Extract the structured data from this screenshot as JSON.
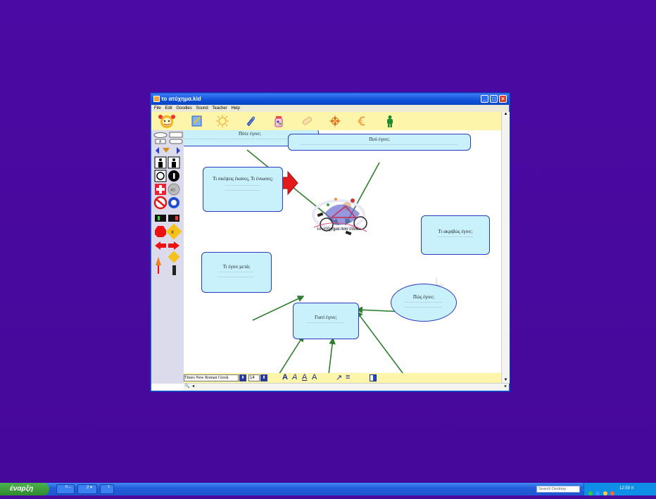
{
  "window": {
    "title": "το ατύχημα.kid",
    "menu": [
      "File",
      "Edit",
      "Goodies",
      "Sound",
      "Teacher",
      "Help"
    ]
  },
  "toolbar": {
    "icons": [
      "kid-avatar-icon",
      "notepad-icon",
      "sun-icon",
      "paperclip-icon",
      "jar-icon",
      "eraser-icon",
      "compass-icon",
      "euro-icon",
      "person-icon"
    ]
  },
  "diagram": {
    "center_caption": "το ατύχημα που είδα",
    "boxes": {
      "when": {
        "text": "Πότε έγινε;",
        "dots": "................................................................................................................"
      },
      "where": {
        "text": "Πού έγινε;",
        "dots": "................................................................................................................"
      },
      "thoughts": {
        "text": "Τι σκέψεις έκανες, Τι ένιωσες;",
        "dots1": ".........................",
        "dots2": "........................."
      },
      "what": {
        "text": "Τι ακριβώς έγινε;",
        "dots": ".........................."
      },
      "after": {
        "text": "Τι έγινε μετά;",
        "dots1": ".........................",
        "dots2": "........................."
      },
      "why": {
        "text": "Γιατί έγινε;",
        "dots": "..........................."
      },
      "how": {
        "text": "Πώς έγινε;",
        "dots1": "...........................",
        "dots2": "..........................."
      }
    }
  },
  "fontbar": {
    "font": "Times New Roman Greek",
    "size": "14"
  },
  "taskbar": {
    "start_label": "έναρξη",
    "task1": "n...",
    "task2": "2 ▾",
    "task3": "τ.",
    "search_placeholder": "Search Desktop",
    "clock": "12:59 π"
  }
}
